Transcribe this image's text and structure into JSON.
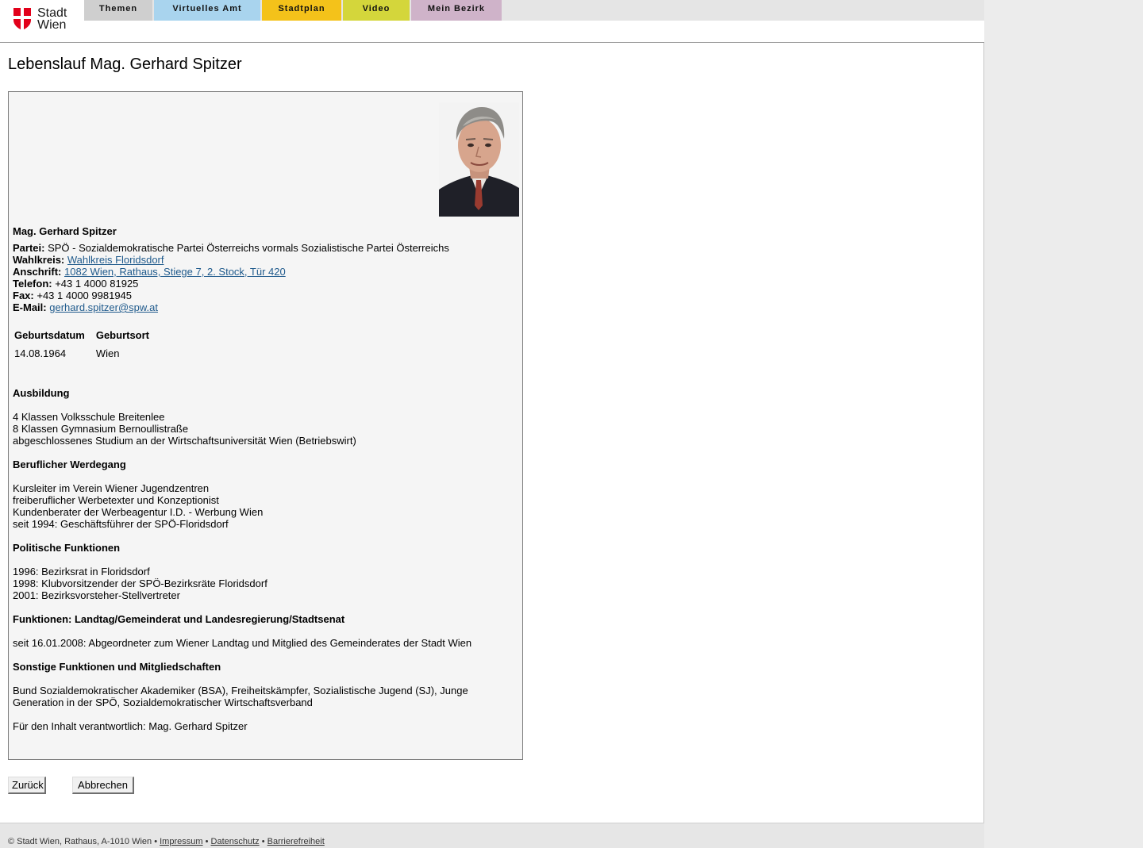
{
  "header": {
    "logo_line1": "Stadt",
    "logo_line2": "Wien",
    "nav": [
      {
        "label": "Themen",
        "color": "#cfcfcf"
      },
      {
        "label": "Virtuelles Amt",
        "color": "#a9d4ee"
      },
      {
        "label": "Stadtplan",
        "color": "#f4c21a"
      },
      {
        "label": "Video",
        "color": "#d4d63b"
      },
      {
        "label": "Mein Bezirk",
        "color": "#cfb3c9"
      }
    ]
  },
  "page_title": "Lebenslauf Mag. Gerhard Spitzer",
  "profile": {
    "name": "Mag. Gerhard Spitzer",
    "partei_label": "Partei:",
    "partei_value": "SPÖ - Sozialdemokratische Partei Österreichs vormals Sozialistische Partei Österreichs",
    "wahlkreis_label": "Wahlkreis:",
    "wahlkreis_value": "Wahlkreis Floridsdorf",
    "anschrift_label": "Anschrift:",
    "anschrift_value": "1082 Wien, Rathaus, Stiege 7, 2. Stock, Tür 420",
    "telefon_label": "Telefon:",
    "telefon_value": "+43 1 4000 81925",
    "fax_label": "Fax:",
    "fax_value": "+43 1 4000 9981945",
    "email_label": "E-Mail:",
    "email_value": "gerhard.spitzer@spw.at",
    "birth_headers": [
      "Geburtsdatum",
      "Geburtsort"
    ],
    "birth_values": [
      "14.08.1964",
      "Wien"
    ]
  },
  "sections": [
    {
      "title": "Ausbildung",
      "lines": [
        "4 Klassen Volksschule Breitenlee",
        "8 Klassen Gymnasium Bernoullistraße",
        "abgeschlossenes Studium an der Wirtschaftsuniversität Wien (Betriebswirt)"
      ]
    },
    {
      "title": "Beruflicher Werdegang",
      "lines": [
        "Kursleiter im Verein Wiener Jugendzentren",
        "freiberuflicher Werbetexter und Konzeptionist",
        "Kundenberater der Werbeagentur I.D. - Werbung Wien",
        "seit 1994: Geschäftsführer der SPÖ-Floridsdorf"
      ]
    },
    {
      "title": "Politische Funktionen",
      "lines": [
        "1996: Bezirksrat in Floridsdorf",
        "1998: Klubvorsitzender der SPÖ-Bezirksräte Floridsdorf",
        "2001: Bezirksvorsteher-Stellvertreter"
      ]
    },
    {
      "title": "Funktionen: Landtag/Gemeinderat und Landesregierung/Stadtsenat",
      "lines": [
        "seit 16.01.2008: Abgeordneter zum Wiener Landtag und Mitglied des Gemeinderates der Stadt Wien"
      ]
    },
    {
      "title": "Sonstige Funktionen und Mitgliedschaften",
      "lines": [
        "Bund Sozialdemokratischer Akademiker (BSA), Freiheitskämpfer, Sozialistische Jugend (SJ), Junge",
        "Generation in der SPÖ, Sozialdemokratischer Wirtschaftsverband"
      ]
    }
  ],
  "responsible": "Für den Inhalt verantwortlich: Mag. Gerhard Spitzer",
  "buttons": {
    "back": "Zurück",
    "cancel": "Abbrechen"
  },
  "footer": {
    "copyright": "© Stadt Wien, Rathaus, A-1010 Wien •",
    "impressum": "Impressum",
    "datenschutz": "Datenschutz",
    "barrierefreiheit": "Barrierefreiheit",
    "separator": "•"
  }
}
